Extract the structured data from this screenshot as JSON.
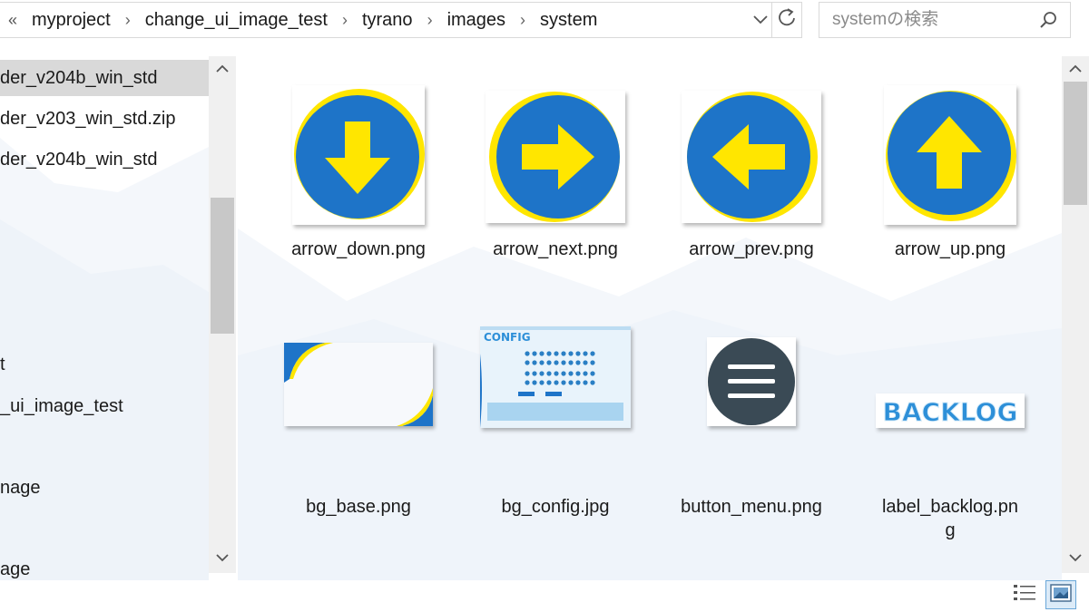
{
  "address_bar": {
    "overflow_label": "«",
    "crumbs": [
      "myproject",
      "change_ui_image_test",
      "tyrano",
      "images",
      "system"
    ],
    "separator": "›"
  },
  "search": {
    "placeholder": "systemの検索"
  },
  "nav": {
    "items": [
      {
        "label": "der_v204b_win_std",
        "selected": true
      },
      {
        "label": "der_v203_win_std.zip",
        "selected": false
      },
      {
        "label": "der_v204b_win_std",
        "selected": false
      },
      {
        "label": "t",
        "selected": false
      },
      {
        "label": "_ui_image_test",
        "selected": false
      },
      {
        "label": "nage",
        "selected": false
      },
      {
        "label": "age",
        "selected": false
      }
    ]
  },
  "files": [
    {
      "name": "arrow_down.png",
      "icon": "arrow-down-circle-icon"
    },
    {
      "name": "arrow_next.png",
      "icon": "arrow-right-circle-icon"
    },
    {
      "name": "arrow_prev.png",
      "icon": "arrow-left-circle-icon"
    },
    {
      "name": "arrow_up.png",
      "icon": "arrow-up-circle-icon"
    },
    {
      "name": "bg_base.png",
      "icon": "bg-base-thumbnail"
    },
    {
      "name": "bg_config.jpg",
      "icon": "config-screen-thumbnail"
    },
    {
      "name": "button_menu.png",
      "icon": "hamburger-menu-circle-icon"
    },
    {
      "name": "label_backlog.png",
      "label_lines": [
        "label_backlog.pn",
        "g"
      ],
      "icon": "backlog-label-thumbnail"
    }
  ],
  "thumb_text": {
    "config_title": "CONFIG",
    "backlog_text": "BACKLOG"
  },
  "colors": {
    "arrow_blue": "#1e74c8",
    "arrow_yellow": "#ffe600",
    "menu_dark": "#3a4a55",
    "selection_gray": "#d9d9d9",
    "view_active": "#dcebf8"
  }
}
